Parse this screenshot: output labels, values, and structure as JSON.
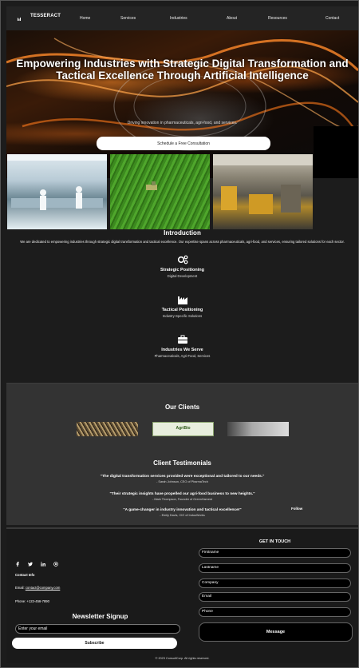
{
  "nav": {
    "brand": "TESSERACT",
    "links": [
      "Home",
      "Services",
      "Industries",
      "About",
      "Resources",
      "Contact"
    ]
  },
  "hero": {
    "title": "Empowering Industries with Strategic Digital Transformation and Tactical Excellence Through Artificial Intelligence",
    "subtitle": "Driving innovation in pharmaceuticals, agri-food, and services.",
    "cta": "Schedule a Free Consultation"
  },
  "intro": {
    "title": "Introduction",
    "text": "We are dedicated to empowering industries through strategic digital transformation and tactical excellence. Our expertise spans across pharmaceuticals, agri-food, and services, ensuring tailored solutions for each sector.",
    "features": [
      {
        "icon": "gears-icon",
        "title": "Strategic Positioning",
        "desc": "Digital Development"
      },
      {
        "icon": "industry-icon",
        "title": "Tactical Positioning",
        "desc": "Industry-Specific Solutions"
      },
      {
        "icon": "briefcase-icon",
        "title": "Industries We Serve",
        "desc": "Pharmaceuticals, Agri-Food, Services"
      }
    ]
  },
  "clients": {
    "title": "Our Clients",
    "logo2_text": "AgriBio",
    "testimonials_title": "Client Testimonials",
    "testimonials": [
      {
        "quote": "\"The digital transformation services provided were exceptional and tailored to our needs.\"",
        "author": "- Sarah Johnson, CEO of PharmaTech"
      },
      {
        "quote": "\"Their strategic insights have propelled our agri-food business to new heights.\"",
        "author": "- Mark Thompson, Founder of GreenHarvest"
      },
      {
        "quote": "\"A game-changer in industry innovation and tactical excellence!\"",
        "author": "- Emily Davis, CIO of InduoWorks"
      }
    ],
    "follow": "Follow"
  },
  "footer": {
    "contact_info": "Contact Info",
    "email_label": "Email: ",
    "email": "contact@company.com",
    "phone": "Phone: +123-456-7890",
    "newsletter_title": "Newsletter Signup",
    "newsletter_placeholder": "Enter your email",
    "subscribe": "Subscribe",
    "copyright": "© 2023 ConsultCorp. All rights reserved.",
    "get_in_touch": "GET IN TOUCH",
    "fields": [
      "Firstname",
      "Lastname",
      "Company",
      "Email",
      "Phone"
    ],
    "message": "Message"
  }
}
